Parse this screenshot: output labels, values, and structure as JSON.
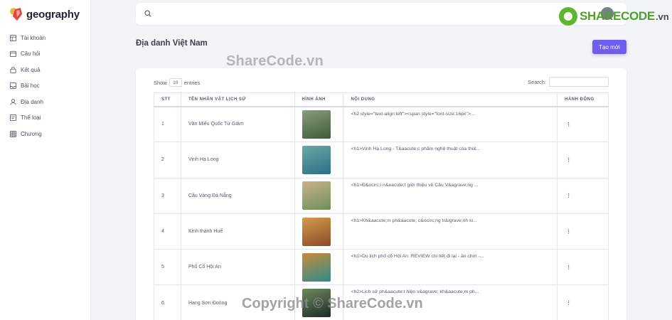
{
  "app": {
    "brand": "geography"
  },
  "sidebar": {
    "items": [
      {
        "label": "Tài khoản",
        "icon": "table-icon"
      },
      {
        "label": "Câu hỏi",
        "icon": "calendar-icon"
      },
      {
        "label": "Kết quả",
        "icon": "bag-icon"
      },
      {
        "label": "Bài học",
        "icon": "inbox-icon"
      },
      {
        "label": "Địa danh",
        "icon": "user-icon"
      },
      {
        "label": "Thể loại",
        "icon": "message-icon"
      },
      {
        "label": "Chương",
        "icon": "grid-icon"
      }
    ]
  },
  "topbar": {
    "search_placeholder": ""
  },
  "watermark": {
    "logo_main": "SHARECODE",
    "logo_tld": ".vn",
    "mid": "ShareCode.vn",
    "bottom": "Copyright © ShareCode.vn"
  },
  "page": {
    "title": "Địa danh Việt Nam",
    "create_button": "Tạo mới"
  },
  "table_controls": {
    "show_label": "Show",
    "show_value": "10",
    "entries_label": "entries",
    "search_label": "Search:"
  },
  "table": {
    "headers": {
      "stt": "STT",
      "name": "TÊN NHÂN VẬT LỊCH SỬ",
      "image": "HÌNH ẢNH",
      "content": "NỘI DUNG",
      "action": "HÀNH ĐỘNG"
    },
    "rows": [
      {
        "stt": "1",
        "name": "Văn Miếu Quốc Tử Giám",
        "content": "<h2 style=\"text-align:left\"><span style=\"font-size:16px\">...",
        "action": "⋮",
        "img_colors": [
          "#3d5a3a",
          "#8a9d7c"
        ]
      },
      {
        "stt": "2",
        "name": "Vịnh Hạ Long",
        "content": "<h1>Vịnh Hạ Long - T&aacute;c phẩm nghệ thuật của thi&...",
        "action": "⋮",
        "img_colors": [
          "#2c6f86",
          "#6aa8a6"
        ]
      },
      {
        "stt": "3",
        "name": "Cầu Vàng Đà Nẵng",
        "content": "<h1>Đ&ocirc;i n&eacute;t giới thiệu về Cầu V&agrave;ng ...",
        "action": "⋮",
        "img_colors": [
          "#6d8f5a",
          "#c9b487"
        ]
      },
      {
        "stt": "4",
        "name": "Kinh thành Huế",
        "content": "<h1>Kh&aacute;m ph&aacute; c&ocirc;ng tr&igrave;nh ki...",
        "action": "⋮",
        "img_colors": [
          "#8a4a2a",
          "#d49b4a"
        ]
      },
      {
        "stt": "5",
        "name": "Phố Cổ Hội An",
        "content": "<h1>Du lịch phố cổ Hội An: REVIEW chi tiết đi lại - ăn chơi -...",
        "action": "⋮",
        "img_colors": [
          "#2d8c8a",
          "#c98a3d"
        ]
      },
      {
        "stt": "6",
        "name": "Hang Sơn Đoòng",
        "content": "<h2>Lịch sử ph&aacute;t hiện v&agrave; kh&aacute;m ph...",
        "action": "⋮",
        "img_colors": [
          "#1d2a24",
          "#6f8b5d"
        ]
      }
    ]
  },
  "colors": {
    "accent": "#6f5df0",
    "sharecode_green": "#4ea127"
  }
}
